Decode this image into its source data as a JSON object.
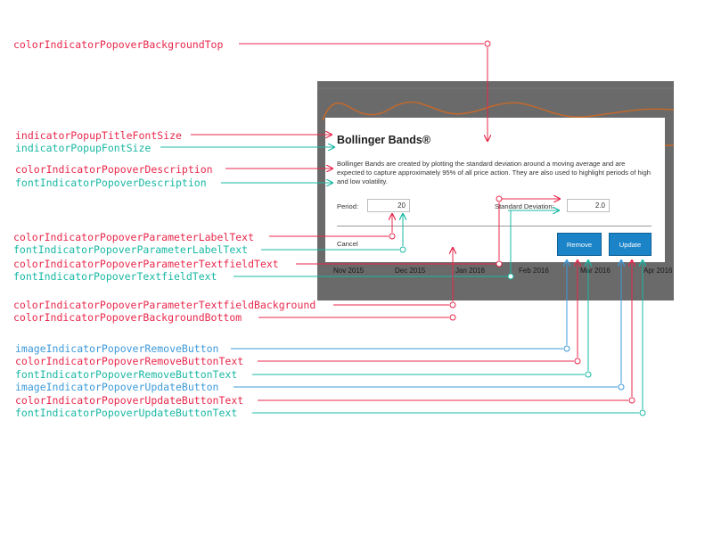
{
  "screenshot": {
    "axis_labels": [
      "Nov 2015",
      "Dec 2015",
      "Jan 2016",
      "Feb 2016",
      "Mar 2016",
      "Apr 2016"
    ]
  },
  "dialog": {
    "title": "Bollinger Bands®",
    "description": "Bollinger Bands are created by plotting the standard deviation around a moving average and are expected to capture approximately 95% of all price action. They are also used to highlight periods of high and low volatility.",
    "period_label": "Period:",
    "period_value": "20",
    "std_label": "Standard Deviation:",
    "std_value": "2.0",
    "cancel_label": "Cancel",
    "remove_label": "Remove",
    "update_label": "Update"
  },
  "annotations": {
    "background_top": "colorIndicatorPopoverBackgroundTop",
    "title_font_size": "indicatorPopupTitleFontSize",
    "font_size": "indicatorPopupFontSize",
    "description_color": "colorIndicatorPopoverDescription",
    "description_font": "fontIndicatorPopoverDescription",
    "param_label_color": "colorIndicatorPopoverParameterLabelText",
    "param_label_font": "fontIndicatorPopoverParameterLabelText",
    "param_textfield_color": "colorIndicatorPopoverParameterTextfieldText",
    "textfield_font": "fontIndicatorPopoverTextfieldText",
    "textfield_background": "colorIndicatorPopoverParameterTextfieldBackground",
    "background_bottom": "colorIndicatorPopoverBackgroundBottom",
    "remove_button_image": "imageIndicatorPopoverRemoveButton",
    "remove_button_color": "colorIndicatorPopoverRemoveButtonText",
    "remove_button_font": "fontIndicatorPopoverRemoveButtonText",
    "update_button_image": "imageIndicatorPopoverUpdateButton",
    "update_button_color": "colorIndicatorPopoverUpdateButtonText",
    "update_button_font": "fontIndicatorPopoverUpdateButtonText"
  },
  "colors": {
    "red": "#e8274b",
    "teal": "#19b8a4",
    "blue": "#3d99d9",
    "button": "#1b84c8"
  }
}
